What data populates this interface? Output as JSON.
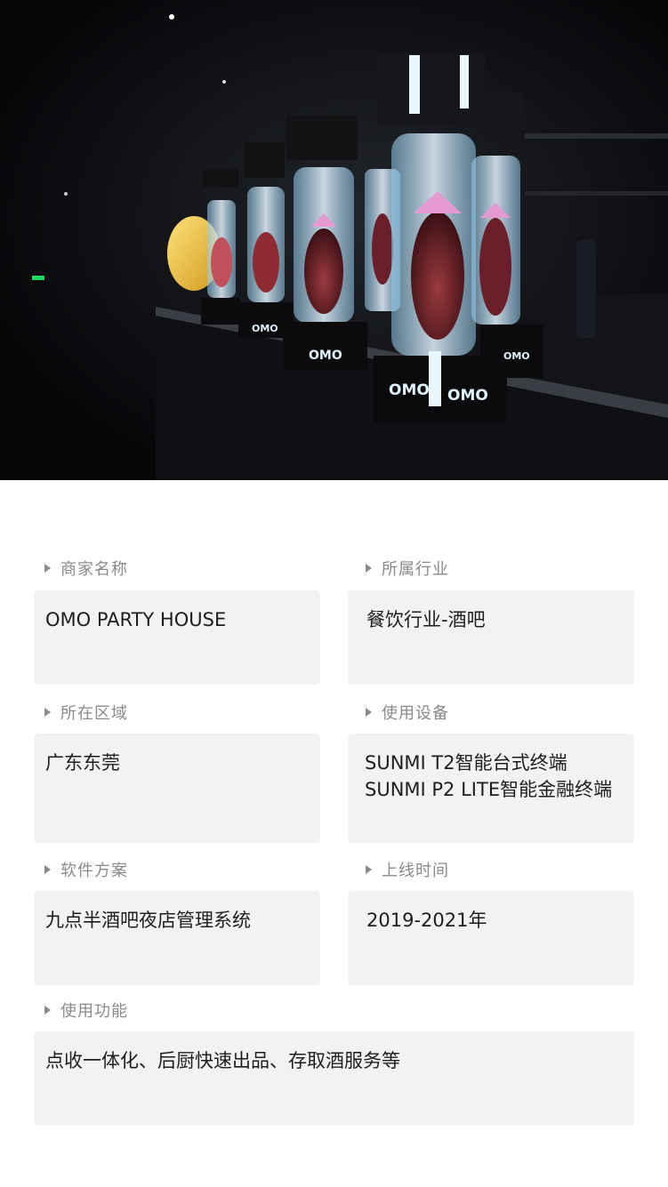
{
  "hero": {
    "alt": "Bar counter with illuminated bottle display cases",
    "brand_mark": "OMO"
  },
  "fields": {
    "merchant": {
      "label": "商家名称",
      "value": "OMO PARTY HOUSE"
    },
    "industry": {
      "label": "所属行业",
      "value": "餐饮行业-酒吧"
    },
    "region": {
      "label": "所在区域",
      "value": "广东东莞"
    },
    "devices": {
      "label": "使用设备",
      "values": [
        "SUNMI T2智能台式终端",
        "SUNMI P2 LITE智能金融终端"
      ]
    },
    "software": {
      "label": "软件方案",
      "value": "九点半酒吧夜店管理系统"
    },
    "online_time": {
      "label": "上线时间",
      "value": "2019-2021年"
    },
    "features": {
      "label": "使用功能",
      "value": "点收一体化、后厨快速出品、存取酒服务等"
    }
  },
  "colors": {
    "label": "#8a8a8a",
    "box": "#f2f2f2",
    "text": "#1e1e1e",
    "glow": "#bfe8ff"
  }
}
